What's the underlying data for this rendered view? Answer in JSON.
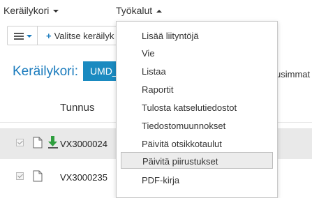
{
  "menubar": {
    "menus": [
      {
        "label": "Keräilykori"
      },
      {
        "label": "Työkalut"
      }
    ]
  },
  "toolbar": {
    "select_label": "Valitse keräilyk"
  },
  "page": {
    "title": "Keräilykori:",
    "badge": "UMD_",
    "right_text": "usimmat"
  },
  "table": {
    "column_header": "Tunnus",
    "rows": [
      {
        "id": "VX3000024",
        "has_download": true,
        "selected": true
      },
      {
        "id": "VX3000235",
        "has_download": false,
        "selected": false
      }
    ]
  },
  "dropdown": {
    "items": [
      {
        "label": "Lisää liityntöjä"
      },
      {
        "label": "Vie"
      },
      {
        "label": "Listaa"
      },
      {
        "label": "Raportit"
      },
      {
        "label": "Tulosta katselutiedostot"
      },
      {
        "label": "Tiedostomuunnokset"
      },
      {
        "label": "Päivitä otsikkotaulut"
      },
      {
        "label": "Päivitä piirustukset",
        "highlighted": true
      },
      {
        "label": "PDF-kirja"
      }
    ]
  },
  "colors": {
    "accent": "#1a7bbd",
    "badge": "#1a8ac0",
    "download_arrow": "#2e9e3e",
    "selected_row": "#e9e9e9"
  },
  "icons": [
    "chevron-down-icon",
    "chevron-up-icon",
    "hamburger-icon",
    "plus-icon",
    "checkbox-icon",
    "document-icon",
    "download-arrow-icon"
  ]
}
